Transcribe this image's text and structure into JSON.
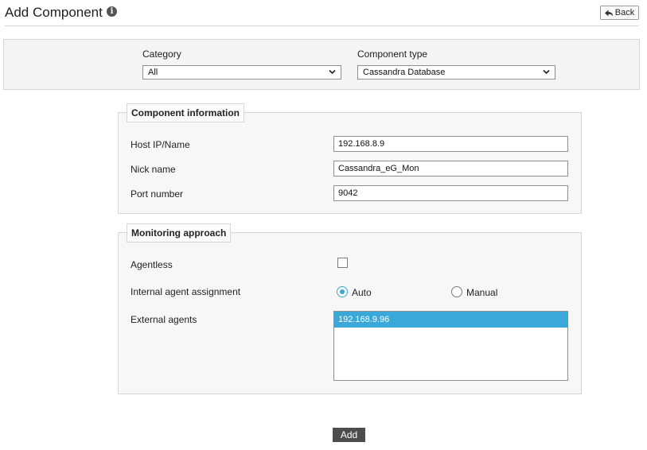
{
  "header": {
    "title": "Add Component",
    "info_icon": "info-circle-icon",
    "back_label": "Back",
    "back_icon": "reply-arrow-icon"
  },
  "filters": {
    "category_label": "Category",
    "category_value": "All",
    "component_type_label": "Component type",
    "component_type_value": "Cassandra Database"
  },
  "component_information": {
    "legend": "Component information",
    "host_label": "Host IP/Name",
    "host_value": "192.168.8.9",
    "nick_label": "Nick name",
    "nick_value": "Cassandra_eG_Mon",
    "port_label": "Port number",
    "port_value": "9042"
  },
  "monitoring_approach": {
    "legend": "Monitoring approach",
    "agentless_label": "Agentless",
    "agentless_checked": false,
    "internal_label": "Internal agent assignment",
    "auto_label": "Auto",
    "manual_label": "Manual",
    "selected_assignment": "Auto",
    "external_label": "External agents",
    "external_agents": [
      "192.168.9.96"
    ]
  },
  "actions": {
    "add_label": "Add"
  },
  "colors": {
    "accent": "#3aa8d8",
    "button_dark": "#4d4d4d",
    "panel_bg": "#f4f4f4",
    "border": "#d6d6d6"
  }
}
